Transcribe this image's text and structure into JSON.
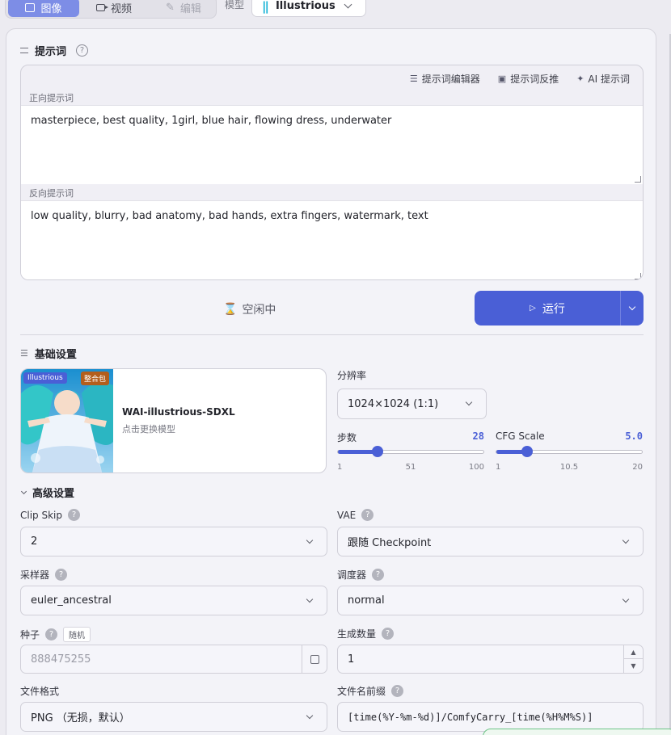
{
  "top_bar": {
    "tabs": [
      {
        "label": "图像",
        "icon": "image-icon",
        "active": true
      },
      {
        "label": "视频",
        "icon": "video-icon",
        "active": false
      },
      {
        "label": "编辑",
        "icon": "edit-icon",
        "active": false,
        "disabled": true
      }
    ],
    "model_label": "模型",
    "model_value": "Illustrious"
  },
  "prompts": {
    "section_title": "提示词",
    "tools": [
      "提示词编辑器",
      "提示词反推",
      "AI 提示词"
    ],
    "positive_label": "正向提示词",
    "positive_value": "masterpiece, best quality, 1girl, blue hair, flowing dress, underwater",
    "negative_label": "反向提示词",
    "negative_value": "low quality, blurry, bad anatomy, bad hands, extra fingers, watermark, text"
  },
  "run": {
    "status": "空闲中",
    "button_label": "运行"
  },
  "basic": {
    "section_title": "基础设置",
    "model_card": {
      "tag_model": "Illustrious",
      "tag_bundle": "整合包",
      "name": "WAI-illustrious-SDXL",
      "hint": "点击更换模型"
    },
    "resolution_label": "分辨率",
    "resolution_value": "1024×1024 (1:1)",
    "steps": {
      "label": "步数",
      "value": "28",
      "min": "1",
      "mid": "51",
      "max": "100",
      "fraction": 0.273
    },
    "cfg": {
      "label": "CFG Scale",
      "value": "5.0",
      "min": "1",
      "mid": "10.5",
      "max": "20",
      "fraction": 0.211
    }
  },
  "advanced": {
    "section_title": "高级设置",
    "clip_skip_label": "Clip Skip",
    "clip_skip_value": "2",
    "vae_label": "VAE",
    "vae_value": "跟随 Checkpoint",
    "sampler_label": "采样器",
    "sampler_value": "euler_ancestral",
    "scheduler_label": "调度器",
    "scheduler_value": "normal",
    "seed_label": "种子",
    "seed_random_tag": "随机",
    "seed_placeholder": "888475255",
    "batch_label": "生成数量",
    "batch_value": "1",
    "format_label": "文件格式",
    "format_value": "PNG （无损，默认）",
    "prefix_label": "文件名前缀",
    "prefix_value": "[time(%Y-%m-%d)]/ComfyCarry_[time(%H%M%S)]"
  },
  "colors": {
    "accent": "#4a5fd6",
    "bundle_tag": "#b35e1c"
  }
}
